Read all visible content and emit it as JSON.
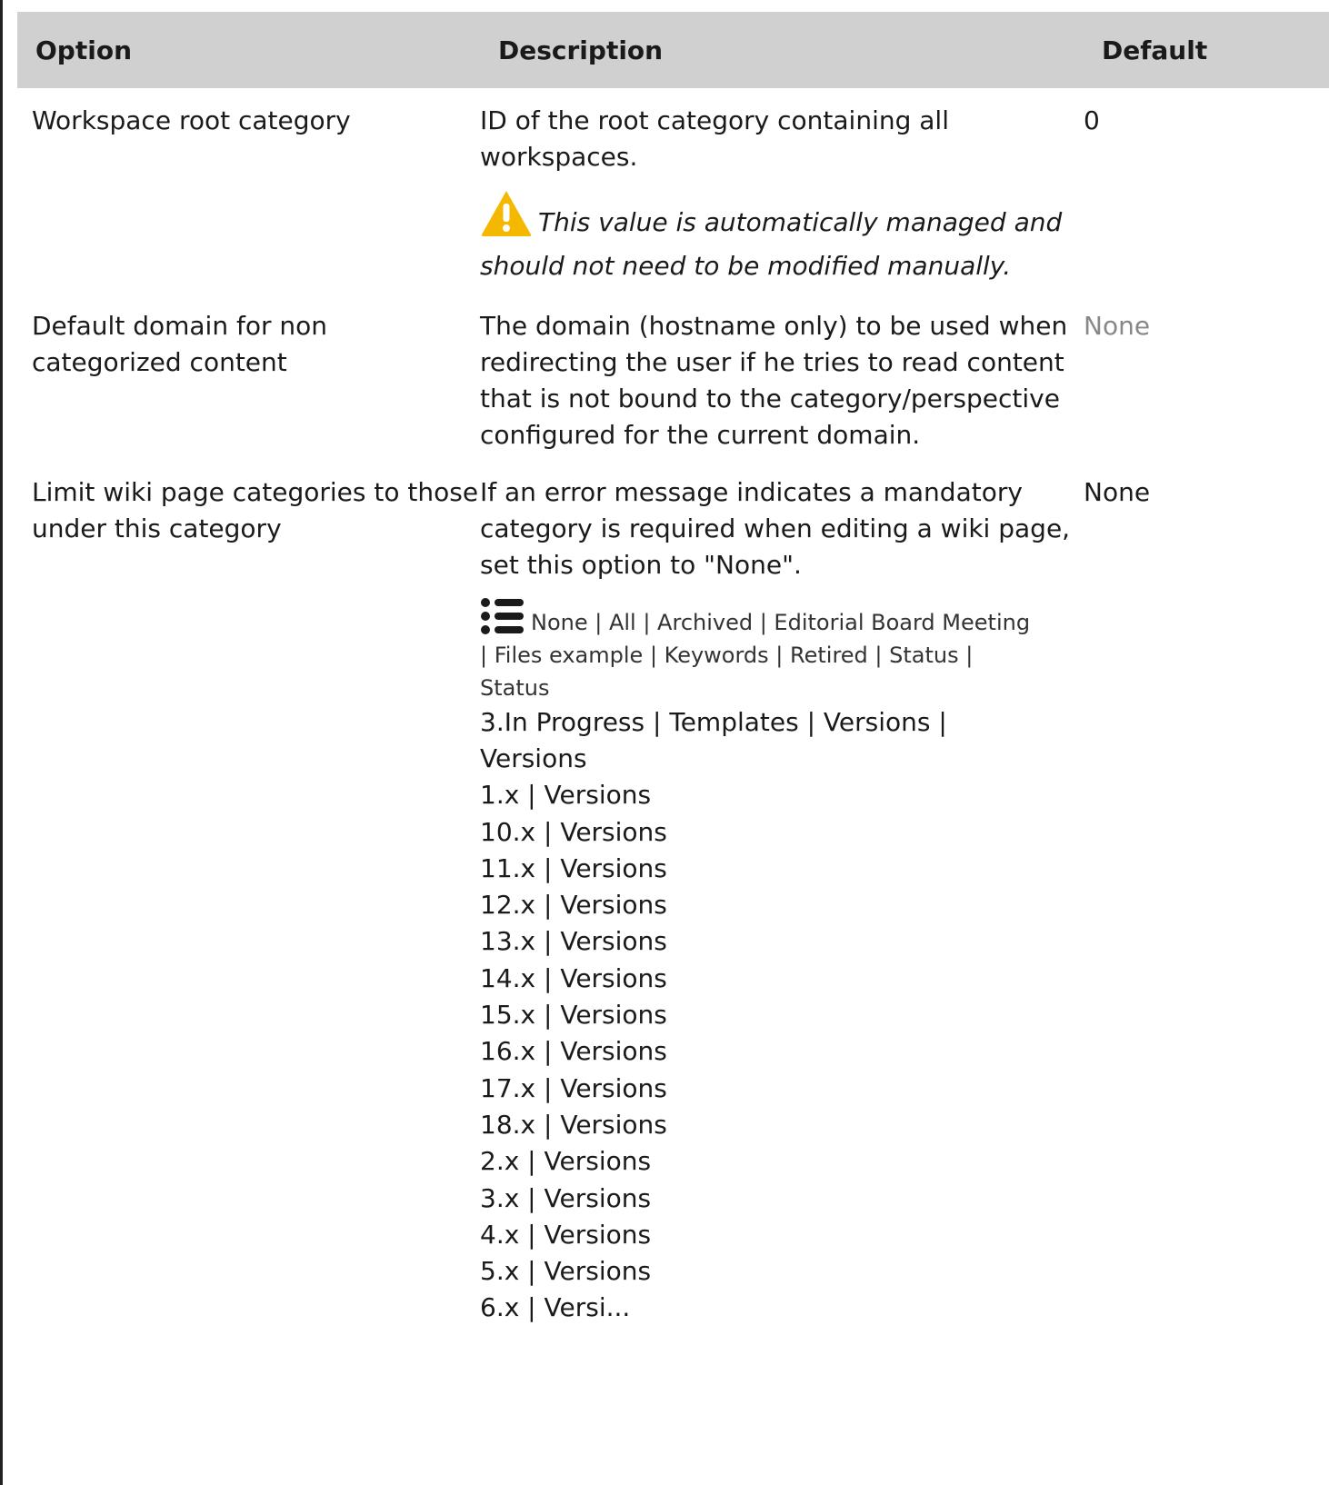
{
  "table": {
    "headers": {
      "option": "Option",
      "description": "Description",
      "default": "Default"
    },
    "rows": [
      {
        "option": "Workspace root category",
        "description": "ID of the root category containing all workspaces.",
        "warning": "This value is automatically managed and should not need to be modified manually.",
        "default": "0"
      },
      {
        "option": "Default domain for non categorized content",
        "description": "The domain (hostname only) to be used when redirecting the user if he tries to read content that is not bound to the category/perspective configured for the current domain.",
        "default": "None"
      },
      {
        "option": "Limit wiki page categories to those under this category",
        "description": "If an error message indicates a mandatory category is required when editing a wiki page, set this option to \"None\".",
        "category_list_line1": "None | All | Archived | Editorial Board Meeting",
        "category_list_line2": "| Files example | Keywords | Retired | Status |",
        "category_list_line3": "Status",
        "lines": [
          "3.In Progress | Templates | Versions |",
          "Versions",
          "1.x | Versions",
          "10.x | Versions",
          "11.x | Versions",
          "12.x | Versions",
          "13.x | Versions",
          "14.x | Versions",
          "15.x | Versions",
          "16.x | Versions",
          "17.x | Versions",
          "18.x | Versions",
          "2.x | Versions",
          "3.x | Versions",
          "4.x | Versions",
          "5.x | Versions",
          "6.x | Versi..."
        ],
        "default": "None"
      }
    ]
  },
  "icons": {
    "warning": "warning-triangle-icon",
    "list": "list-icon"
  },
  "colors": {
    "header_bg": "#d0d0d0",
    "warning": "#f5b800",
    "muted": "#888888"
  }
}
